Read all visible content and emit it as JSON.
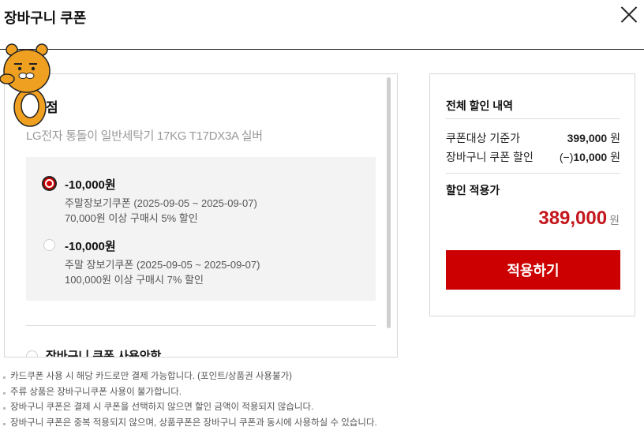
{
  "header": {
    "title": "장바구니 쿠폰"
  },
  "left": {
    "store_name": "점",
    "product_name": "LG전자 통돌이 일반세탁기 17KG T17DX3A 실버",
    "coupons": [
      {
        "amount": "-10,000원",
        "name": "주말장보기쿠폰 (2025-09-05 ~ 2025-09-07)",
        "condition": "70,000원 이상 구매시 5% 할인",
        "selected": true
      },
      {
        "amount": "-10,000원",
        "name": "주말 장보기쿠폰 (2025-09-05 ~ 2025-09-07)",
        "condition": "100,000원 이상 구매시 7% 할인",
        "selected": false
      }
    ],
    "no_coupon_label": "장바구니 쿠폰 사용안함"
  },
  "summary": {
    "title": "전체 할인 내역",
    "base_label": "쿠폰대상 기준가",
    "base_value": "399,000",
    "unit": "원",
    "discount_label": "장바구니 쿠폰 할인",
    "discount_prefix": "(−)",
    "discount_value": "10,000",
    "final_label": "할인 적용가",
    "final_value": "389,000",
    "apply_label": "적용하기",
    "accent_color": "#cc0000"
  },
  "notes": [
    "카드쿠폰 사용 시 해당 카드로만 결제 가능합니다. (포인트/상품권 사용불가)",
    "주류 상품은 장바구니쿠폰 사용이 불가합니다.",
    "장바구니 쿠폰은 결제 시 쿠폰을 선택하지 않으면 할인 금액이 적용되지 않습니다.",
    "장바구니 쿠폰은 중복 적용되지 않으며, 상품쿠폰은 장바구니 쿠폰과 동시에 사용하실 수 있습니다."
  ]
}
